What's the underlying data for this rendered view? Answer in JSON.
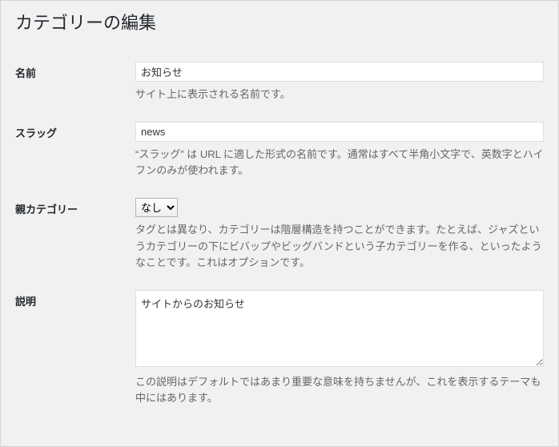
{
  "page": {
    "title": "カテゴリーの編集"
  },
  "fields": {
    "name": {
      "label": "名前",
      "value": "お知らせ",
      "help": "サイト上に表示される名前です。"
    },
    "slug": {
      "label": "スラッグ",
      "value": "news",
      "help": "“スラッグ” は URL に適した形式の名前です。通常はすべて半角小文字で、英数字とハイフンのみが使われます。"
    },
    "parent": {
      "label": "親カテゴリー",
      "selected": "なし",
      "help": "タグとは異なり、カテゴリーは階層構造を持つことができます。たとえば、ジャズというカテゴリーの下にビバップやビッグバンドという子カテゴリーを作る、といったようなことです。これはオプションです。"
    },
    "description": {
      "label": "説明",
      "value": "サイトからのお知らせ",
      "help": "この説明はデフォルトではあまり重要な意味を持ちませんが、これを表示するテーマも中にはあります。"
    }
  }
}
